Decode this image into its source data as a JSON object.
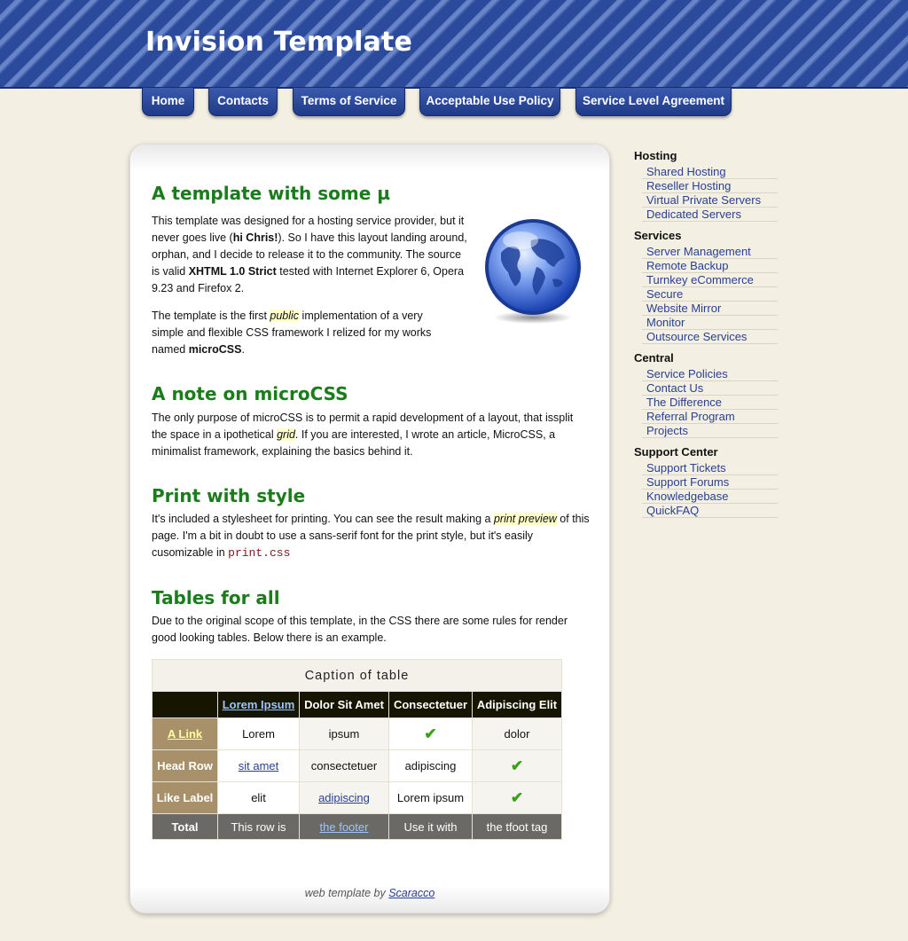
{
  "header": {
    "title": "Invision Template"
  },
  "nav": [
    {
      "label": "Home"
    },
    {
      "label": "Contacts"
    },
    {
      "label": "Terms of Service"
    },
    {
      "label": "Acceptable Use Policy"
    },
    {
      "label": "Service Level Agreement"
    }
  ],
  "main": {
    "section1": {
      "title": "A template with some µ",
      "p1_a": "This template was designed for a hosting service provider, but it never goes live (",
      "p1_b": "hi Chris!",
      "p1_c": "). So I have this layout landing around, orphan, and I decide to release it to the community. The source is valid ",
      "p1_d": "XHTML 1.0 Strict",
      "p1_e": " tested with Internet Explorer 6, Opera 9.23 and Firefox 2.",
      "p2_a": "The template is the first ",
      "p2_b": "public",
      "p2_c": " implementation of a very simple and flexible CSS framework I relized for my works named ",
      "p2_d": "microCSS",
      "p2_e": "."
    },
    "section2": {
      "title": "A note on microCSS",
      "p_a": "The only purpose of microCSS is to permit a rapid development of a layout, that issplit the space in a ipothetical ",
      "p_b": "grid",
      "p_c": ". If you are interested, I wrote an article, MicroCSS, a minimalist framework, explaining the basics behind it."
    },
    "section3": {
      "title": "Print with style",
      "p_a": "It's included a stylesheet for printing. You can see the result making a ",
      "p_b": "print preview",
      "p_c": " of this page. I'm a bit in doubt to use a sans-serif font for the print style, but it's easily cusomizable in ",
      "p_d": "print.css"
    },
    "section4": {
      "title": "Tables for all",
      "p": "Due to the original scope of this template, in the CSS there are some rules for render good looking tables. Below there is an example."
    },
    "table": {
      "caption": "Caption of table",
      "headers": [
        "Lorem Ipsum",
        "Dolor Sit Amet",
        "Consectetuer",
        "Adipiscing Elit"
      ],
      "rows": [
        {
          "label": "A Link",
          "cells": [
            "Lorem",
            "ipsum",
            "✔",
            "dolor"
          ]
        },
        {
          "label": "Head Row",
          "cells": [
            "sit amet",
            "consectetuer",
            "adipiscing",
            "✔"
          ]
        },
        {
          "label": "Like Label",
          "cells": [
            "elit",
            "adipiscing",
            "Lorem ipsum",
            "✔"
          ]
        }
      ],
      "footer": {
        "label": "Total",
        "cells": [
          "This row is",
          "the footer",
          "Use it with",
          "the tfoot tag"
        ]
      }
    },
    "credit": {
      "prefix": "web template by ",
      "author": "Scaracco"
    }
  },
  "sidebar": [
    {
      "heading": "Hosting",
      "items": [
        "Shared Hosting",
        "Reseller Hosting",
        "Virtual Private Servers",
        "Dedicated Servers"
      ]
    },
    {
      "heading": "Services",
      "items": [
        "Server Management",
        "Remote Backup",
        "Turnkey eCommerce",
        "Secure",
        "Website Mirror",
        "Monitor",
        "Outsource Services"
      ]
    },
    {
      "heading": "Central",
      "items": [
        "Service Policies",
        "Contact Us",
        "The Difference",
        "Referral Program",
        "Projects"
      ]
    },
    {
      "heading": "Support Center",
      "items": [
        "Support Tickets",
        "Support Forums",
        "Knowledgebase",
        "QuickFAQ"
      ]
    }
  ],
  "colors": {
    "header_blue": "#26428f",
    "heading_green": "#1a7c1a",
    "link_blue": "#2a4090",
    "background": "#f3efe2"
  },
  "icons": {
    "globe": "globe-icon",
    "check": "checkmark-icon"
  }
}
